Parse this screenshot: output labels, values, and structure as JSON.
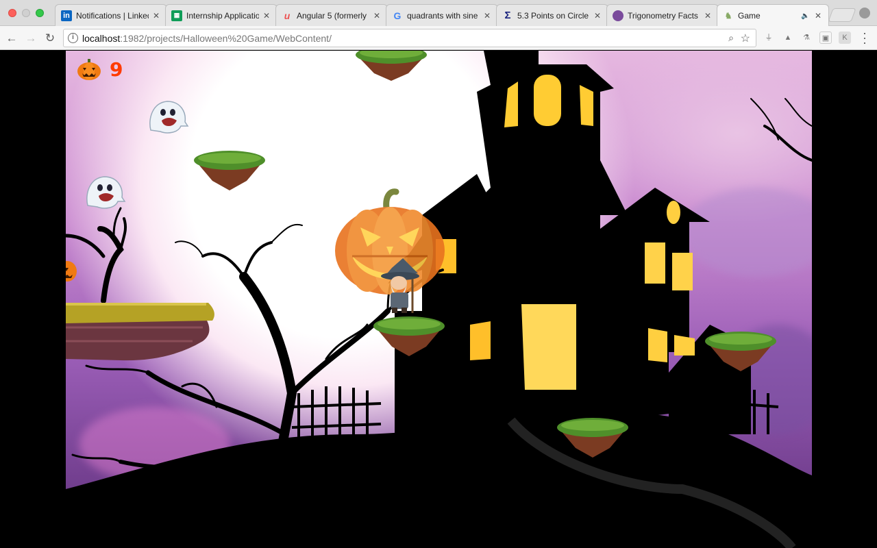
{
  "browser": {
    "tabs": [
      {
        "title": "Notifications | LinkedIn",
        "favicon": "linkedin-icon",
        "active": false
      },
      {
        "title": "Internship Application",
        "favicon": "sheets-icon",
        "active": false
      },
      {
        "title": "Angular 5 (formerly",
        "favicon": "udemy-icon",
        "active": false
      },
      {
        "title": "quadrants with sine",
        "favicon": "google-icon",
        "active": false
      },
      {
        "title": "5.3 Points on Circle",
        "favicon": "sigma-icon",
        "active": false
      },
      {
        "title": "Trigonometry Facts",
        "favicon": "globe-icon",
        "active": false
      },
      {
        "title": "Game",
        "favicon": "game-icon",
        "active": true,
        "audio": true
      }
    ],
    "address": {
      "host": "localhost",
      "path": ":1982/projects/Halloween%20Game/WebContent/"
    },
    "colors": {
      "linkedin": "#0a66c2",
      "sheets": "#0f9d58",
      "udemy": "#ec5252",
      "sigma": "#1a237e"
    }
  },
  "game": {
    "score_label": "9",
    "score_icon": "pumpkin-icon",
    "player": "wizard",
    "enemies": [
      "ghost",
      "ghost",
      "giant-pumpkin"
    ],
    "colors": {
      "score": "#ff3b00",
      "grass": "#4f8f2a",
      "dirt": "#7b3b22",
      "silhouette": "#000000",
      "window": "#ffcc33"
    }
  }
}
